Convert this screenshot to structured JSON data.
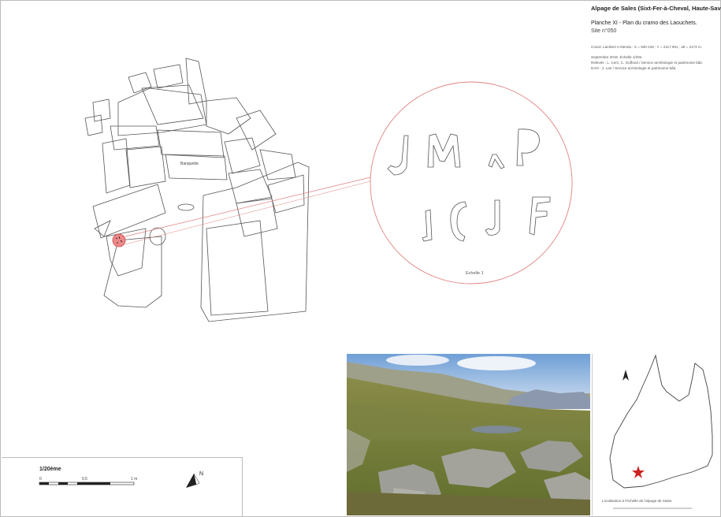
{
  "title_block": {
    "title": "Alpage de Sales (Sixt-Fer-à-Cheval, Haute-Savoie)",
    "planche": "Planche XI - Plan du cramo des Laouchets.",
    "site": "Site n°050",
    "coords": "Coord. Lambert II étendu : X = 940 018 ; Y = 2117 901 ; alt = 2174 m.",
    "date": "Septembre 2015. Échelle 1/20e.",
    "releves": "Relevés : L. Cerz, C. Guffond / Service archéologie et patrimoine bâti.",
    "dao": "DAO : J. Lair / Service archéologie et patrimoine bâti."
  },
  "plan": {
    "banquette_label": "Banquette",
    "echelle_label": "Echelle 1",
    "highlight_color": "#e06060",
    "inscriptions": {
      "line1": "JM ^ P",
      "line2": "I C J F"
    }
  },
  "scale": {
    "title": "1/20ème",
    "tick_0": "0",
    "tick_05": "0,5",
    "tick_1": "1 m",
    "north": "N"
  },
  "location_map": {
    "caption": "Localisation à l'échelle de l'alpage de Sales",
    "marker_color": "#cc2222",
    "north": "N"
  }
}
